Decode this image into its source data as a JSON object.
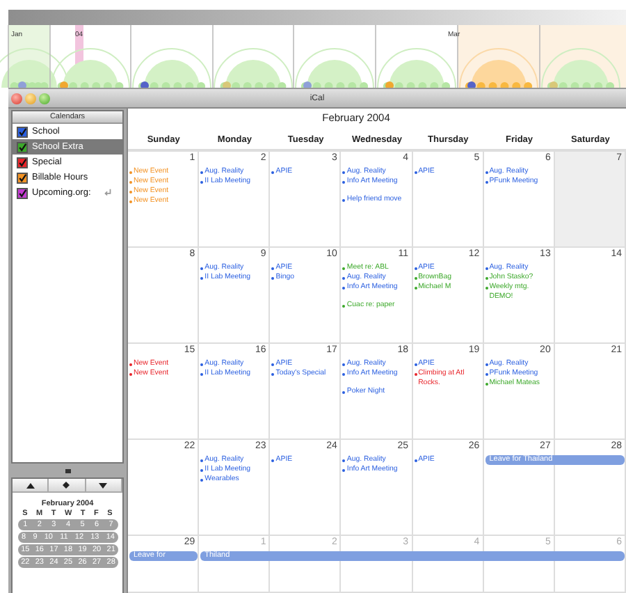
{
  "timeline": {
    "labels": [
      "Jan",
      "04",
      "Mar"
    ]
  },
  "window": {
    "title": "iCal"
  },
  "calendars": {
    "header": "Calendars",
    "items": [
      {
        "label": "School",
        "color": "#2a5fe0",
        "checked": true,
        "selected": false,
        "subscribed": false
      },
      {
        "label": "School Extra",
        "color": "#3ca82a",
        "checked": true,
        "selected": true,
        "subscribed": false
      },
      {
        "label": "Special",
        "color": "#e8242a",
        "checked": true,
        "selected": false,
        "subscribed": false
      },
      {
        "label": "Billable Hours",
        "color": "#f39325",
        "checked": true,
        "selected": false,
        "subscribed": false
      },
      {
        "label": "Upcoming.org:",
        "color": "#c23ad0",
        "checked": true,
        "selected": false,
        "subscribed": true
      }
    ]
  },
  "mini_calendar": {
    "title": "February 2004",
    "weekdays": [
      "S",
      "M",
      "T",
      "W",
      "T",
      "F",
      "S"
    ],
    "weeks": [
      [
        "1",
        "2",
        "3",
        "4",
        "5",
        "6",
        "7"
      ],
      [
        "8",
        "9",
        "10",
        "11",
        "12",
        "13",
        "14"
      ],
      [
        "15",
        "16",
        "17",
        "18",
        "19",
        "20",
        "21"
      ],
      [
        "22",
        "23",
        "24",
        "25",
        "26",
        "27",
        "28"
      ]
    ]
  },
  "month": {
    "title": "February 2004",
    "weekdays": [
      "Sunday",
      "Monday",
      "Tuesday",
      "Wednesday",
      "Thursday",
      "Friday",
      "Saturday"
    ],
    "weeks": [
      {
        "days": [
          {
            "number": "1",
            "events": [
              {
                "title": "New Event",
                "color": "#f39325"
              },
              {
                "title": "New Event",
                "color": "#f39325"
              },
              {
                "title": "New Event",
                "color": "#f39325"
              },
              {
                "title": "New Event",
                "color": "#f39325"
              }
            ]
          },
          {
            "number": "2",
            "events": [
              {
                "title": "Aug. Reality",
                "color": "#2a5fe0"
              },
              {
                "title": "II Lab Meeting",
                "color": "#2a5fe0"
              }
            ]
          },
          {
            "number": "3",
            "events": [
              {
                "title": "APIE",
                "color": "#2a5fe0"
              }
            ]
          },
          {
            "number": "4",
            "events": [
              {
                "title": "Aug. Reality",
                "color": "#2a5fe0"
              },
              {
                "title": "Info Art Meeting",
                "color": "#2a5fe0"
              },
              {
                "title": "Help friend move",
                "color": "#2a5fe0",
                "spaced": true
              }
            ]
          },
          {
            "number": "5",
            "events": [
              {
                "title": "APIE",
                "color": "#2a5fe0"
              }
            ]
          },
          {
            "number": "6",
            "events": [
              {
                "title": "Aug. Reality",
                "color": "#2a5fe0"
              },
              {
                "title": "PFunk Meeting",
                "color": "#2a5fe0"
              }
            ]
          },
          {
            "number": "7",
            "highlighted": true
          }
        ]
      },
      {
        "days": [
          {
            "number": "8"
          },
          {
            "number": "9",
            "events": [
              {
                "title": "Aug. Reality",
                "color": "#2a5fe0"
              },
              {
                "title": "II Lab Meeting",
                "color": "#2a5fe0"
              }
            ]
          },
          {
            "number": "10",
            "events": [
              {
                "title": "APIE",
                "color": "#2a5fe0"
              },
              {
                "title": "Bingo",
                "color": "#2a5fe0"
              }
            ]
          },
          {
            "number": "11",
            "events": [
              {
                "title": "Meet re: ABL",
                "color": "#3ca82a"
              },
              {
                "title": "Aug. Reality",
                "color": "#2a5fe0"
              },
              {
                "title": "Info Art Meeting",
                "color": "#2a5fe0"
              },
              {
                "title": "Cuac re: paper",
                "color": "#3ca82a",
                "spaced": true
              }
            ]
          },
          {
            "number": "12",
            "events": [
              {
                "title": "APIE",
                "color": "#2a5fe0"
              },
              {
                "title": "BrownBag",
                "color": "#3ca82a"
              },
              {
                "title": "Michael M",
                "color": "#3ca82a"
              }
            ]
          },
          {
            "number": "13",
            "events": [
              {
                "title": "Aug. Reality",
                "color": "#2a5fe0"
              },
              {
                "title": "John Stasko?",
                "color": "#3ca82a"
              },
              {
                "title": "Weekly mtg. DEMO!",
                "color": "#3ca82a"
              }
            ]
          },
          {
            "number": "14"
          }
        ]
      },
      {
        "days": [
          {
            "number": "15",
            "events": [
              {
                "title": "New Event",
                "color": "#e8242a"
              },
              {
                "title": "New Event",
                "color": "#e8242a"
              }
            ]
          },
          {
            "number": "16",
            "events": [
              {
                "title": "Aug. Reality",
                "color": "#2a5fe0"
              },
              {
                "title": "II Lab Meeting",
                "color": "#2a5fe0"
              }
            ]
          },
          {
            "number": "17",
            "events": [
              {
                "title": "APIE",
                "color": "#2a5fe0"
              },
              {
                "title": "Today's Special",
                "color": "#2a5fe0"
              }
            ]
          },
          {
            "number": "18",
            "events": [
              {
                "title": "Aug. Reality",
                "color": "#2a5fe0"
              },
              {
                "title": "Info Art Meeting",
                "color": "#2a5fe0"
              },
              {
                "title": "Poker Night",
                "color": "#2a5fe0",
                "spaced": true
              }
            ]
          },
          {
            "number": "19",
            "events": [
              {
                "title": "APIE",
                "color": "#2a5fe0"
              },
              {
                "title": "Climbing at Atl Rocks.",
                "color": "#e8242a"
              }
            ]
          },
          {
            "number": "20",
            "events": [
              {
                "title": "Aug. Reality",
                "color": "#2a5fe0"
              },
              {
                "title": "PFunk Meeting",
                "color": "#2a5fe0"
              },
              {
                "title": "Michael Mateas",
                "color": "#3ca82a"
              }
            ]
          },
          {
            "number": "21"
          }
        ]
      },
      {
        "days": [
          {
            "number": "22"
          },
          {
            "number": "23",
            "events": [
              {
                "title": "Aug. Reality",
                "color": "#2a5fe0"
              },
              {
                "title": "II Lab Meeting",
                "color": "#2a5fe0"
              },
              {
                "title": "Wearables",
                "color": "#2a5fe0"
              }
            ]
          },
          {
            "number": "24",
            "events": [
              {
                "title": "APIE",
                "color": "#2a5fe0"
              }
            ]
          },
          {
            "number": "25",
            "events": [
              {
                "title": "Aug. Reality",
                "color": "#2a5fe0"
              },
              {
                "title": "Info Art Meeting",
                "color": "#2a5fe0"
              }
            ]
          },
          {
            "number": "26",
            "events": [
              {
                "title": "APIE",
                "color": "#2a5fe0"
              }
            ]
          },
          {
            "number": "27",
            "bar": "Leave for Thailand"
          },
          {
            "number": "28",
            "bar_continues": true
          }
        ]
      },
      {
        "days": [
          {
            "number": "29",
            "bar": "Leave for"
          },
          {
            "number": "1",
            "muted": true,
            "bar": "Thiland"
          },
          {
            "number": "2",
            "muted": true,
            "bar_continues": true
          },
          {
            "number": "3",
            "muted": true,
            "bar_continues": true
          },
          {
            "number": "4",
            "muted": true,
            "bar_continues": true
          },
          {
            "number": "5",
            "muted": true,
            "bar_continues": true
          },
          {
            "number": "6",
            "muted": true,
            "bar_continues": true
          }
        ]
      }
    ]
  }
}
